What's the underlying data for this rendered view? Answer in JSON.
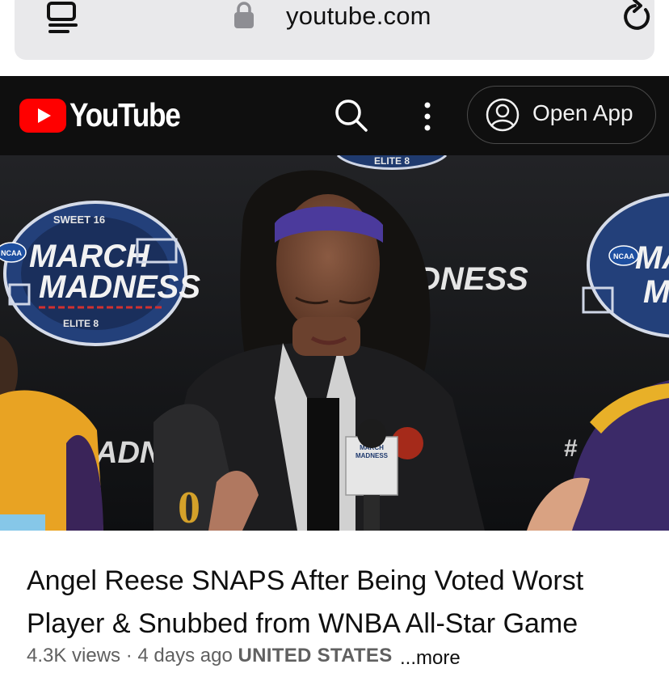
{
  "browser": {
    "url": "youtube.com",
    "icons": [
      "tabs-icon",
      "lock-icon",
      "reload-icon"
    ]
  },
  "header": {
    "brand": "YouTube",
    "open_app_label": "Open App",
    "colors": {
      "background": "#0f0f0f",
      "logo_red": "#ff0000",
      "text": "#ffffff"
    },
    "icons": [
      "youtube-play-logo-icon",
      "search-icon",
      "more-vertical-icon",
      "account-icon"
    ]
  },
  "video": {
    "backdrop_texts": {
      "left_top": "SWEET 16",
      "left_march": "MARCH",
      "left_madness": "MADNESS",
      "left_bottom": "ELITE 8",
      "top_center": "ELITE 8",
      "center_madness": "DNESS",
      "right_ma": "MA",
      "right_m": "M",
      "ncaa": "NCAA",
      "lower_left": "ADN",
      "hashtag": "#",
      "mic_march": "MARCH",
      "mic_madness": "MADNESS"
    }
  },
  "content": {
    "title": "Angel Reese SNAPS After Being Voted Worst Player & Snubbed from WNBA All-Star Game",
    "views": "4.3K views",
    "separator": "·",
    "age": "4 days ago",
    "country": "UNITED STATES",
    "more_label": "...more"
  }
}
